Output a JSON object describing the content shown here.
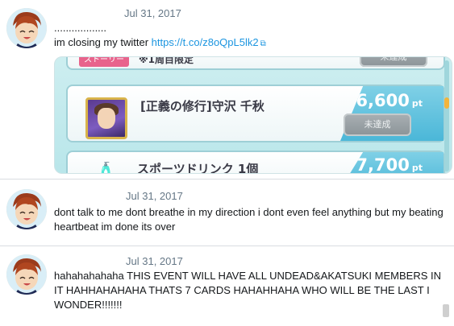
{
  "tweets": [
    {
      "date": "Jul 31, 2017",
      "line1": "..................",
      "text": "im closing my twitter ",
      "link": "https://t.co/z8oQpL5lk2",
      "link_icon": "external-link-icon",
      "media": {
        "top_label": "ストーリー",
        "top_row_text": "※1周目限定",
        "top_status": "未達成",
        "rows": [
          {
            "title": "[正義の修行]守沢 千秋",
            "points": "6,600",
            "unit": "pt",
            "status": "未達成"
          },
          {
            "title": "スポーツドリンク 1個",
            "points": "7,700",
            "unit": "pt"
          }
        ]
      }
    },
    {
      "date": "Jul 31, 2017",
      "text": "dont talk to me dont breathe in my direction i dont even feel anything but my beating heartbeat im done its over"
    },
    {
      "date": "Jul 31, 2017",
      "text": "hahahahahaha THIS EVENT WILL HAVE ALL UNDEAD&AKATSUKI MEMBERS IN IT HAHHAHAHAHA THATS 7 CARDS HAHAHHAHA WHO WILL BE THE LAST I WONDER!!!!!!!"
    }
  ],
  "colors": {
    "link": "#1b95e0",
    "date": "#657786",
    "divider": "#d9dde1"
  }
}
